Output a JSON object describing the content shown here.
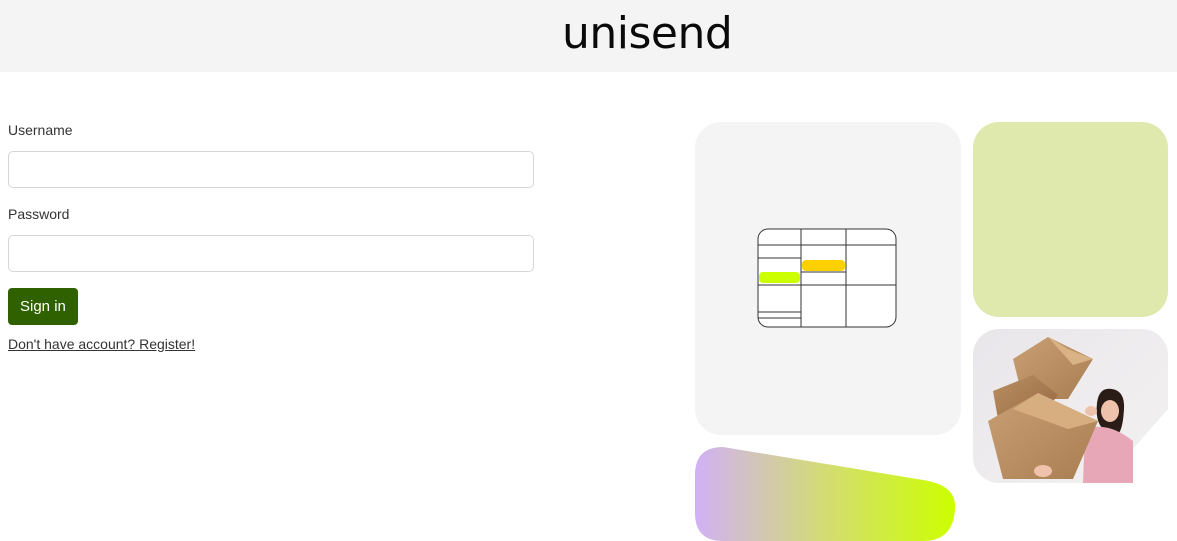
{
  "header": {
    "logo_text": "unisend"
  },
  "login_form": {
    "username_label": "Username",
    "username_value": "",
    "password_label": "Password",
    "password_value": "",
    "signin_label": "Sign in",
    "register_link": "Don't have account? Register!"
  },
  "colors": {
    "signin_button": "#2f6100",
    "header_bg": "#f4f4f4",
    "tile_grey": "#f4f4f4",
    "tile_green": "#dfe9ad",
    "gradient_start": "#d1b1f6",
    "gradient_end": "#ccff00",
    "calendar_yellow": "#ffd000",
    "calendar_lime": "#ccff00"
  }
}
